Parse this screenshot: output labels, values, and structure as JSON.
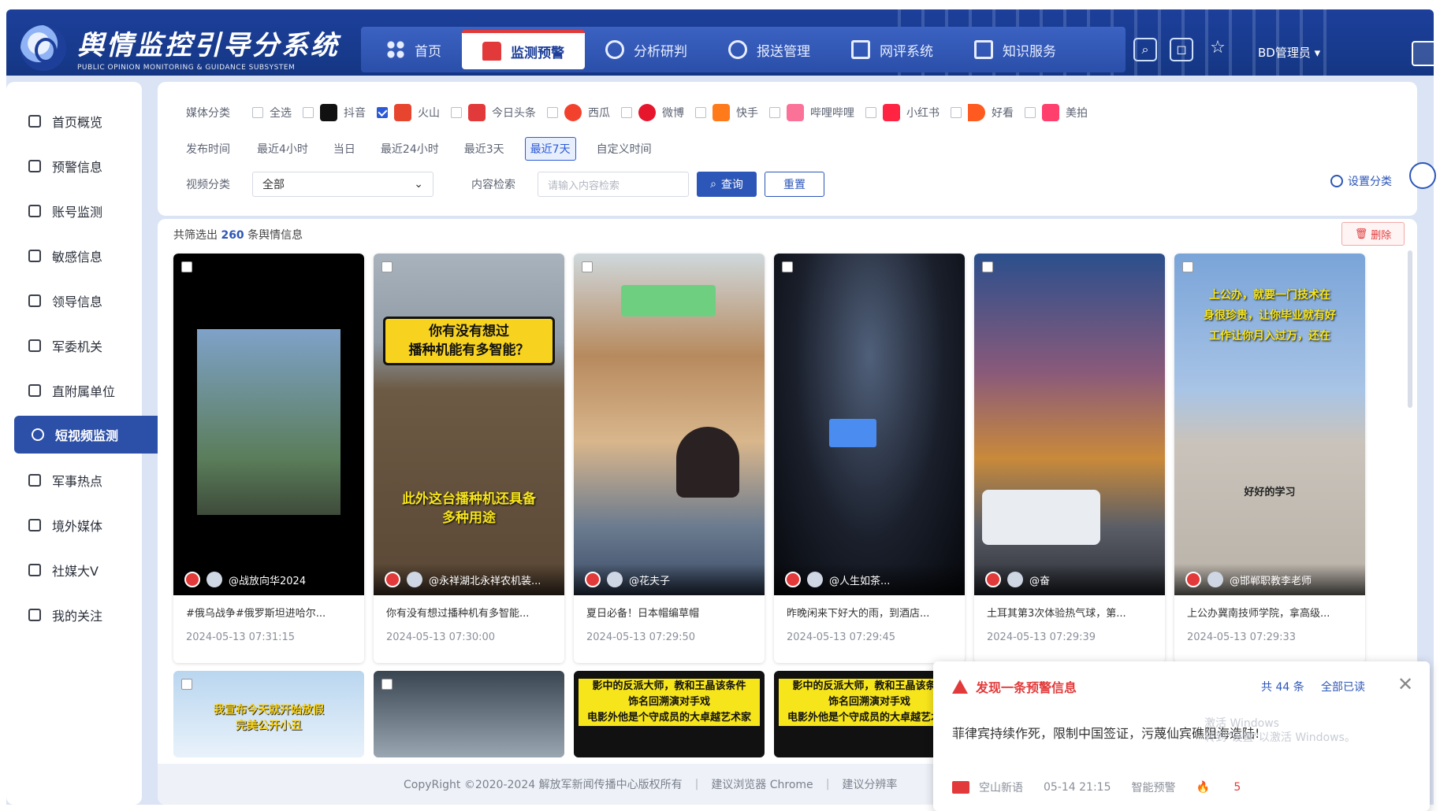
{
  "header": {
    "title": "舆情监控引导分系统",
    "subtitle": "PUBLIC OPINION MONITORING & GUIDANCE SUBSYSTEM",
    "nav": [
      {
        "label": "首页",
        "icon": "home-icon"
      },
      {
        "label": "监测预警",
        "icon": "alarm-icon"
      },
      {
        "label": "分析研判",
        "icon": "analysis-icon"
      },
      {
        "label": "报送管理",
        "icon": "report-icon"
      },
      {
        "label": "网评系统",
        "icon": "comment-icon"
      },
      {
        "label": "知识服务",
        "icon": "knowledge-icon"
      }
    ],
    "user_label": "BD管理员 ▾"
  },
  "sidebar": {
    "items": [
      {
        "label": "首页概览"
      },
      {
        "label": "预警信息"
      },
      {
        "label": "账号监测"
      },
      {
        "label": "敏感信息"
      },
      {
        "label": "领导信息"
      },
      {
        "label": "军委机关"
      },
      {
        "label": "直附属单位"
      },
      {
        "label": "短视频监测"
      },
      {
        "label": "军事热点"
      },
      {
        "label": "境外媒体"
      },
      {
        "label": "社媒大V"
      },
      {
        "label": "我的关注"
      }
    ],
    "active": "短视频监测"
  },
  "filters": {
    "media_label": "媒体分类",
    "media": [
      {
        "label": "全选",
        "checked": false,
        "color": ""
      },
      {
        "label": "抖音",
        "checked": false,
        "color": "#111111"
      },
      {
        "label": "火山",
        "checked": true,
        "color": "#e8452f"
      },
      {
        "label": "今日头条",
        "checked": false,
        "color": "#e23a3a"
      },
      {
        "label": "西瓜",
        "checked": false,
        "color": "#f2422e"
      },
      {
        "label": "微博",
        "checked": false,
        "color": "#e6162d"
      },
      {
        "label": "快手",
        "checked": false,
        "color": "#ff7a1a"
      },
      {
        "label": "哔哩哔哩",
        "checked": false,
        "color": "#fb7299"
      },
      {
        "label": "小红书",
        "checked": false,
        "color": "#ff2442"
      },
      {
        "label": "好看",
        "checked": false,
        "color": "#ff5a1f"
      },
      {
        "label": "美拍",
        "checked": false,
        "color": "#ff3f6c"
      }
    ],
    "time_label": "发布时间",
    "time_options": [
      "最近4小时",
      "当日",
      "最近24小时",
      "最近3天",
      "最近7天",
      "自定义时间"
    ],
    "time_selected": "最近7天",
    "video_label": "视频分类",
    "video_value": "全部",
    "content_label": "内容检索",
    "content_placeholder": "请输入内容检索",
    "query_btn": "查询",
    "reset_btn": "重置",
    "set_category": "设置分类"
  },
  "results": {
    "count_prefix": "共筛选出",
    "count": "260",
    "count_suffix": "条舆情信息",
    "delete_btn": "删除",
    "cards": [
      {
        "caption": "",
        "author": "@战放向华2024",
        "title": "#俄乌战争#俄罗斯坦进哈尔...",
        "time": "2024-05-13 07:31:15"
      },
      {
        "caption": "你有没有想过\n播种机能有多智能？",
        "caption2": "此外这台播种机还具备\n多种用途",
        "author": "@永祥湖北永祥农机装...",
        "title": "你有没有想过播种机有多智能...",
        "time": "2024-05-13 07:30:00"
      },
      {
        "caption": "",
        "author": "@花夫子",
        "title": "夏日必备！日本帽编草帽",
        "time": "2024-05-13 07:29:50"
      },
      {
        "caption": "",
        "author": "@人生如茶...",
        "title": "昨晚闲来下好大的雨，到酒店...",
        "time": "2024-05-13 07:29:45"
      },
      {
        "caption": "",
        "author": "@奋",
        "title": "土耳其第3次体验热气球，第...",
        "time": "2024-05-13 07:29:39"
      },
      {
        "caption": "上公办，就要一门技术在\n身很珍贵，让你毕业就有好\n工作让你月入过万，还在",
        "caption2": "好好的学习",
        "author": "@邯郸职教李老师",
        "title": "上公办冀南技师学院，拿高级...",
        "time": "2024-05-13 07:29:33"
      }
    ],
    "row2": [
      {
        "caption": "我宣布今天就开始放假\n完美公开小丑"
      },
      {
        "caption": ""
      },
      {
        "caption": "影中的反派大师，教和王晶该条件\n饰名回溯演对手戏\n电影外他是个守成员的大卓越艺术家"
      },
      {
        "caption": "影中的反派大师，教和王晶该条件\n饰名回溯演对手戏\n电影外他是个守成员的大卓越艺术家"
      }
    ]
  },
  "footer": {
    "copyright": "CopyRight ©2020-2024 解放军新闻传播中心版权所有",
    "browser": "建议浏览器 Chrome",
    "resolution": "建议分辨率"
  },
  "notification": {
    "title": "发现一条预警信息",
    "count": "共 44 条",
    "read_all": "全部已读",
    "body": "菲律宾持续作死，限制中国签证，污蔑仙宾礁阻海造陆!",
    "watermark": "激活 Windows\n转到\"设置\"以激活 Windows。",
    "source": "空山新语",
    "time": "05-14 21:15",
    "type": "智能预警",
    "hot": "5"
  },
  "colors": {
    "primary": "#1d3f9a",
    "accent": "#2c56b8",
    "danger": "#e23a3a"
  }
}
